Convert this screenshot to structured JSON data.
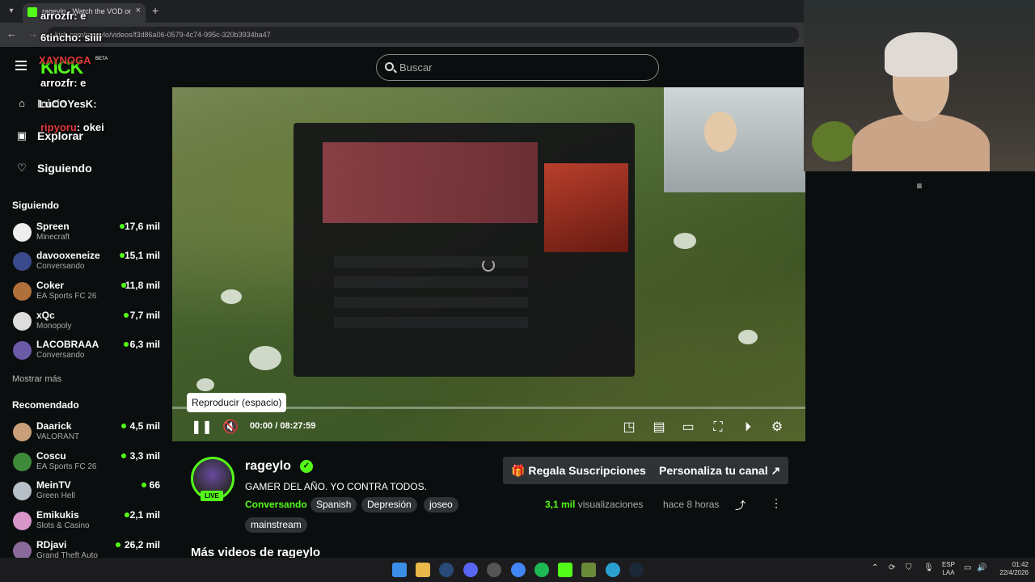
{
  "browser": {
    "tab_title": "rageylo - Watch the VOD on Kick",
    "url": "kick.com/rageylo/videos/f3d86a06-0579-4c74-995c-320b3934ba47"
  },
  "header": {
    "logo": "KICK",
    "logo_badge": "BETA",
    "search_placeholder": "Buscar"
  },
  "sidebar": {
    "nav": [
      {
        "label": "Inicio",
        "icon": "home-icon"
      },
      {
        "label": "Explorar",
        "icon": "explore-icon"
      },
      {
        "label": "Siguiendo",
        "icon": "heart-icon"
      }
    ],
    "following_title": "Siguiendo",
    "following": [
      {
        "name": "Spreen",
        "category": "Minecraft",
        "viewers": "17,6 mil",
        "color": "#eeeeee"
      },
      {
        "name": "davooxeneize",
        "category": "Conversando",
        "viewers": "15,1 mil",
        "color": "#3b4a8a"
      },
      {
        "name": "Coker",
        "category": "EA Sports FC 26",
        "viewers": "11,8 mil",
        "color": "#b0703a"
      },
      {
        "name": "xQc",
        "category": "Monopoly",
        "viewers": "7,7 mil",
        "color": "#dddddd"
      },
      {
        "name": "LACOBRAAA",
        "category": "Conversando",
        "viewers": "6,3 mil",
        "color": "#6a5aa8"
      }
    ],
    "show_more": "Mostrar más",
    "recommended_title": "Recomendado",
    "recommended": [
      {
        "name": "Daarick",
        "category": "VALORANT",
        "viewers": "4,5 mil",
        "color": "#c9a07a"
      },
      {
        "name": "Coscu",
        "category": "EA Sports FC 26",
        "viewers": "3,3 mil",
        "color": "#3f8a3a"
      },
      {
        "name": "MeinTV",
        "category": "Green Hell",
        "viewers": "66",
        "color": "#b7c0c6"
      },
      {
        "name": "Emikukis",
        "category": "Slots & Casino",
        "viewers": "2,1 mil",
        "color": "#d896c8"
      },
      {
        "name": "RDjavi",
        "category": "Grand Theft Auto",
        "viewers": "26,2 mil",
        "color": "#8a6a9a"
      }
    ]
  },
  "chat": [
    {
      "user": "arrozfr",
      "text": "e",
      "color": "#ffffff"
    },
    {
      "user": "6tincho",
      "text": "siiii",
      "color": "#ffffff"
    },
    {
      "user": "XAYNOGA",
      "text": "",
      "color": "#e03c3c"
    },
    {
      "user": "arrozfr",
      "text": "e",
      "color": "#ffffff"
    },
    {
      "user": "LuCOYesK",
      "text": "",
      "color": "#ffffff"
    },
    {
      "user": "ripyoru",
      "text": "okei",
      "color": "#e03c3c"
    }
  ],
  "player": {
    "tooltip": "Reproducir (espacio)",
    "time_current": "00:00",
    "time_sep": "/",
    "time_total": "08:27:59",
    "progress": 0.0
  },
  "stream": {
    "name": "rageylo",
    "live_label": "LIVE",
    "title": "GAMER DEL AÑO. YO CONTRA TODOS.",
    "category": "Conversando",
    "tags": [
      "Spanish",
      "Depresión",
      "joseo",
      "mainstream"
    ],
    "gift_button": "Regala Suscripciones",
    "customize_button": "Personaliza tu canal",
    "views_count": "3,1 mil",
    "views_label": "visualizaciones",
    "time_ago": "hace 8 horas",
    "more_videos": "Más videos de rageylo"
  },
  "taskbar": {
    "lang_top": "ESP",
    "lang_bottom": "LAA",
    "time": "01:42",
    "date": "22/4/2026"
  }
}
